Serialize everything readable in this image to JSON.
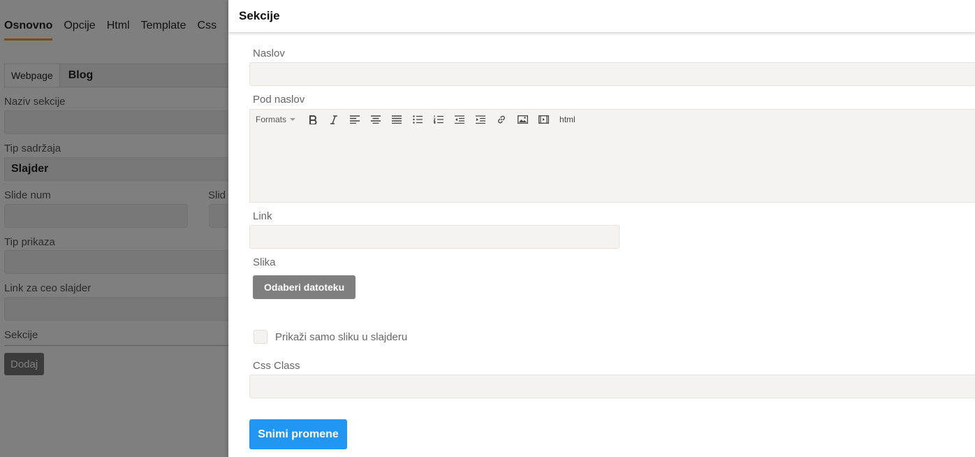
{
  "background": {
    "tabs": [
      "Osnovno",
      "Opcije",
      "Html",
      "Template",
      "Css"
    ],
    "segment": {
      "option1": "Webpage",
      "option2": "Blog"
    },
    "naziv_label": "Naziv sekcije",
    "tip_sadrzaja_label": "Tip sadržaja",
    "tip_sadrzaja_value": "Slajder",
    "slide_num_label": "Slide num",
    "slide_second_label": "Slid",
    "tip_prikaza_label": "Tip prikaza",
    "link_ceo_label": "Link za ceo slajder",
    "sekcije_label": "Sekcije",
    "dodaj_button": "Dodaj"
  },
  "panel": {
    "title": "Sekcije",
    "naslov_label": "Naslov",
    "naslov_value": "",
    "pod_naslov_label": "Pod naslov",
    "editor_toolbar": {
      "formats": "Formats",
      "icons": [
        "bold-icon",
        "italic-icon",
        "align-left-icon",
        "align-center-icon",
        "align-justify-icon",
        "bullet-list-icon",
        "numbered-list-icon",
        "outdent-icon",
        "indent-icon",
        "link-icon",
        "image-icon",
        "media-icon"
      ],
      "html": "html"
    },
    "link_label": "Link",
    "link_value": "",
    "slika_label": "Slika",
    "file_button": "Odaberi datoteku",
    "checkbox_label": "Prikaži samo sliku u slajderu",
    "checkbox_checked": false,
    "css_class_label": "Css Class",
    "css_class_value": "",
    "save_button": "Snimi promene"
  },
  "colors": {
    "accent_tab": "#e0a020",
    "primary_button": "#2196f3",
    "file_button": "#7f7f7f"
  }
}
